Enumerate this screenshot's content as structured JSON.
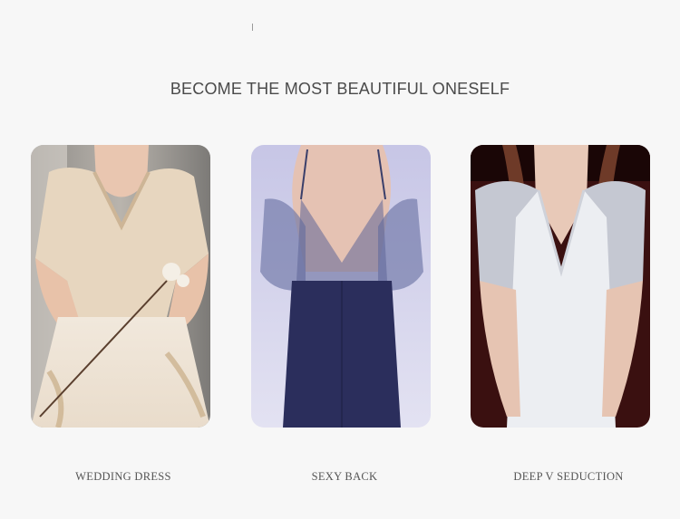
{
  "headline": "BECOME THE MOST BEAUTIFUL ONESELF",
  "cards": [
    {
      "caption": "WEDDING DRESS",
      "image": "wedding-dress-photo"
    },
    {
      "caption": "SEXY BACK",
      "image": "sexy-back-photo"
    },
    {
      "caption": "DEEP V SEDUCTION",
      "image": "deep-v-seduction-photo"
    }
  ],
  "colors": {
    "background": "#f7f7f7",
    "text": "#4a4a4a",
    "caption": "#555555"
  }
}
